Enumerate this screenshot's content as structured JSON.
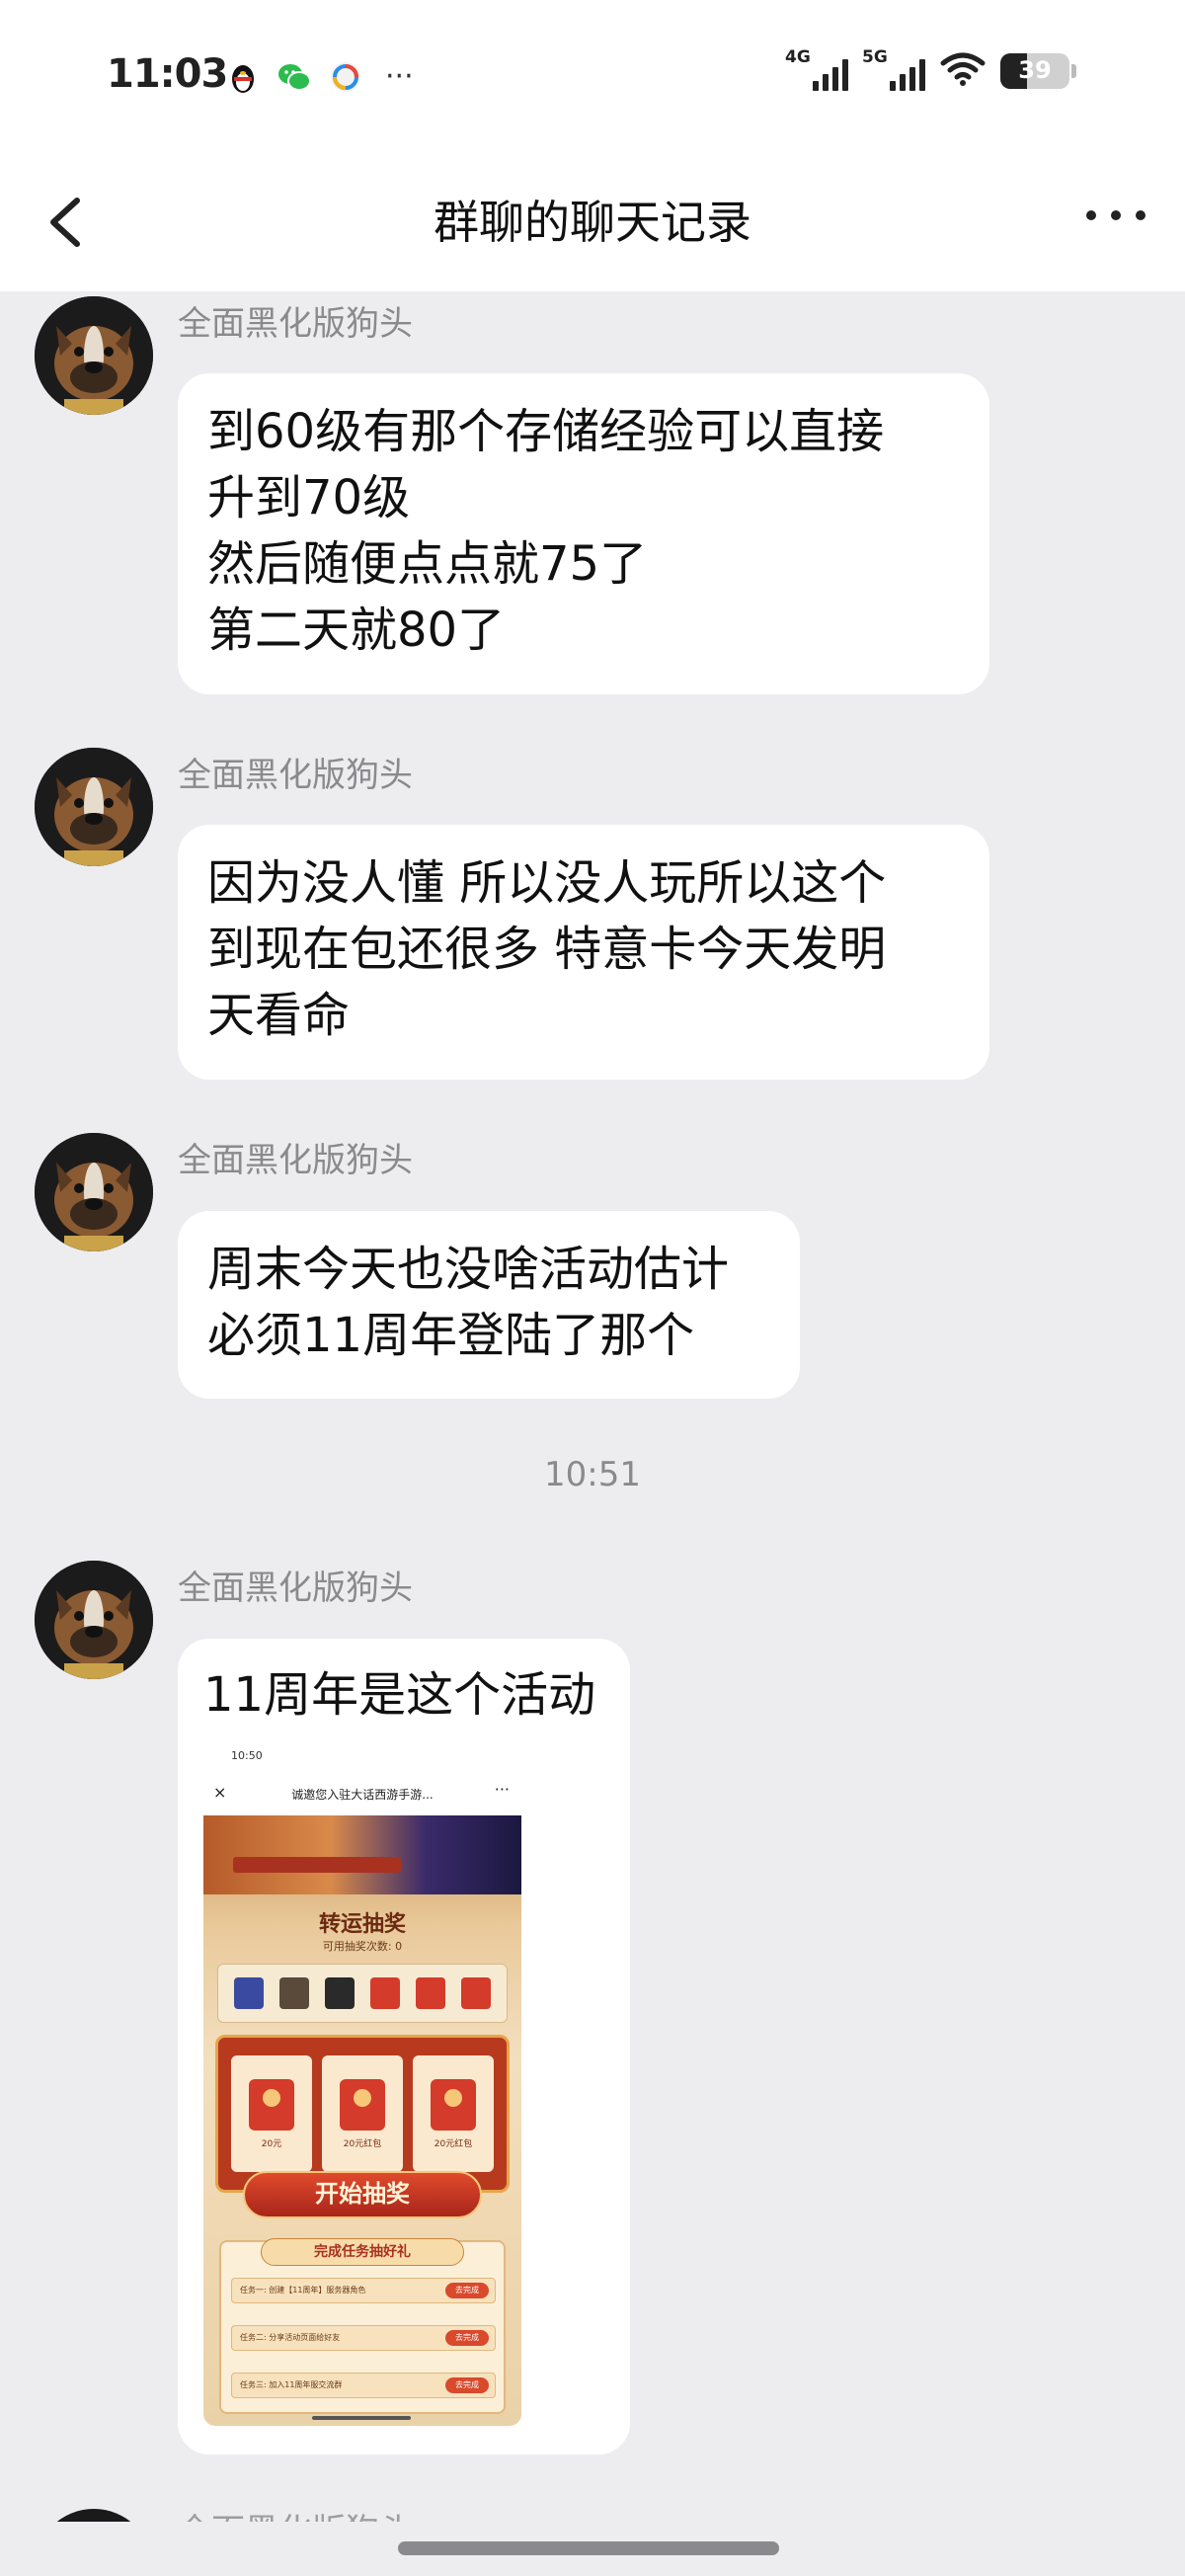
{
  "status_bar": {
    "time": "11:03",
    "app_icons": [
      "qq-penguin-icon",
      "wechat-icon",
      "browser-icon"
    ],
    "more": "···",
    "net1_label": "4G",
    "net2_label": "5G",
    "battery_percent": "39"
  },
  "nav": {
    "title": "群聊的聊天记录"
  },
  "messages": [
    {
      "sender": "全面黑化版狗头",
      "lines": [
        "到60级有那个存储经验可以直接",
        "升到70级",
        "然后随便点点就75了",
        "第二天就80了"
      ]
    },
    {
      "sender": "全面黑化版狗头",
      "lines": [
        "因为没人懂 所以没人玩所以这个",
        "到现在包还很多 特意卡今天发明",
        "天看命"
      ]
    },
    {
      "sender": "全面黑化版狗头",
      "lines": [
        "周末今天也没啥活动估计",
        "必须11周年登陆了那个"
      ]
    },
    {
      "timestamp": "10:51"
    },
    {
      "sender": "全面黑化版狗头",
      "lines": [
        "11周年是这个活动"
      ],
      "image": {
        "status_time": "10:50",
        "page_title": "诚邀您入驻大话西游手游...",
        "close": "×",
        "menu": "···",
        "lottery_title": "转运抽奖",
        "lottery_count": "可用抽奖次数: 0",
        "slot_labels": [
          "20元",
          "20元红包",
          "20元红包"
        ],
        "start_button": "开始抽奖",
        "task_header": "完成任务抽好礼",
        "tasks": [
          {
            "text": "任务一: 创建【11周年】服务器角色",
            "action": "去完成"
          },
          {
            "text": "任务二: 分享活动页面给好友",
            "action": "去完成"
          },
          {
            "text": "任务三: 加入11周年服交流群",
            "action": "去完成"
          }
        ]
      }
    }
  ],
  "partial_sender": "全面黑化版狗头",
  "colors": {
    "background": "#ededf0",
    "bubble": "#ffffff",
    "meta_text": "#8a8a8e"
  }
}
